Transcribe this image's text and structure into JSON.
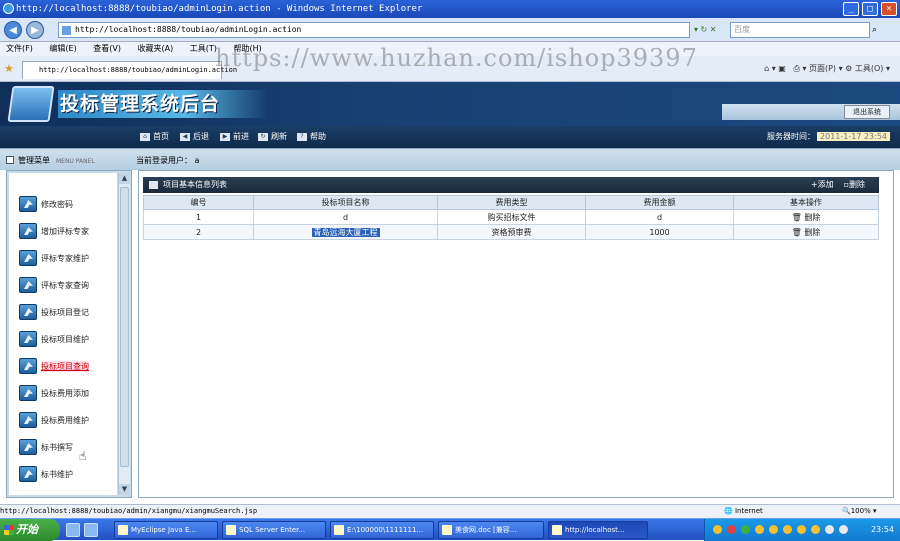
{
  "window": {
    "title": "http://localhost:8888/toubiao/adminLogin.action - Windows Internet Explorer"
  },
  "browser": {
    "address": "http://localhost:8888/toubiao/adminLogin.action",
    "search_placeholder": "百度",
    "menu": [
      "文件(F)",
      "编辑(E)",
      "查看(V)",
      "收藏夹(A)",
      "工具(T)",
      "帮助(H)"
    ],
    "tab_title": "http://localhost:8888/toubiao/adminLogin.action",
    "toolbar_right": [
      "页面(P)",
      "工具(O)"
    ]
  },
  "watermark": "https://www.huzhan.com/ishop39397",
  "app": {
    "title": "投标管理系统后台",
    "exit_label": "退出系统",
    "nav": [
      "首页",
      "后退",
      "前进",
      "刷新",
      "帮助"
    ],
    "server_time_label": "服务器时间：",
    "server_time_value": "2011-1-17 23:54",
    "menu_header": "管理菜单",
    "menu_header_sub": "MENU PANEL",
    "current_user_label": "当前登录用户：",
    "current_user": "a",
    "side_menu": [
      "修改密码",
      "增加评标专家",
      "评标专家维护",
      "评标专家查询",
      "投标项目登记",
      "投标项目维护",
      "投标项目查询",
      "投标费用添加",
      "投标费用维护",
      "标书撰写",
      "标书维护"
    ],
    "active_menu_index": 6,
    "list_title": "项目基本信息列表",
    "add_label": "+添加",
    "delete_label": "删除",
    "table": {
      "headers": [
        "编号",
        "投标项目名称",
        "费用类型",
        "费用金额",
        "基本操作"
      ],
      "rows": [
        [
          "1",
          "d",
          "购买招标文件",
          "d",
          "删除"
        ],
        [
          "2",
          "青岛远海大厦工程",
          "资格预审费",
          "1000",
          "删除"
        ]
      ]
    }
  },
  "status": {
    "url": "http://localhost:8888/toubiao/admin/xiangmu/xiangmuSearch.jsp",
    "zone": "Internet",
    "zoom": "100%"
  },
  "taskbar": {
    "start": "开始",
    "tasks": [
      "MyEclipse Java E...",
      "SQL Server Enter...",
      "E:\\100000\\1111111...",
      "美食网.doc [兼容...",
      "http://localhost..."
    ],
    "clock": "23:54"
  }
}
